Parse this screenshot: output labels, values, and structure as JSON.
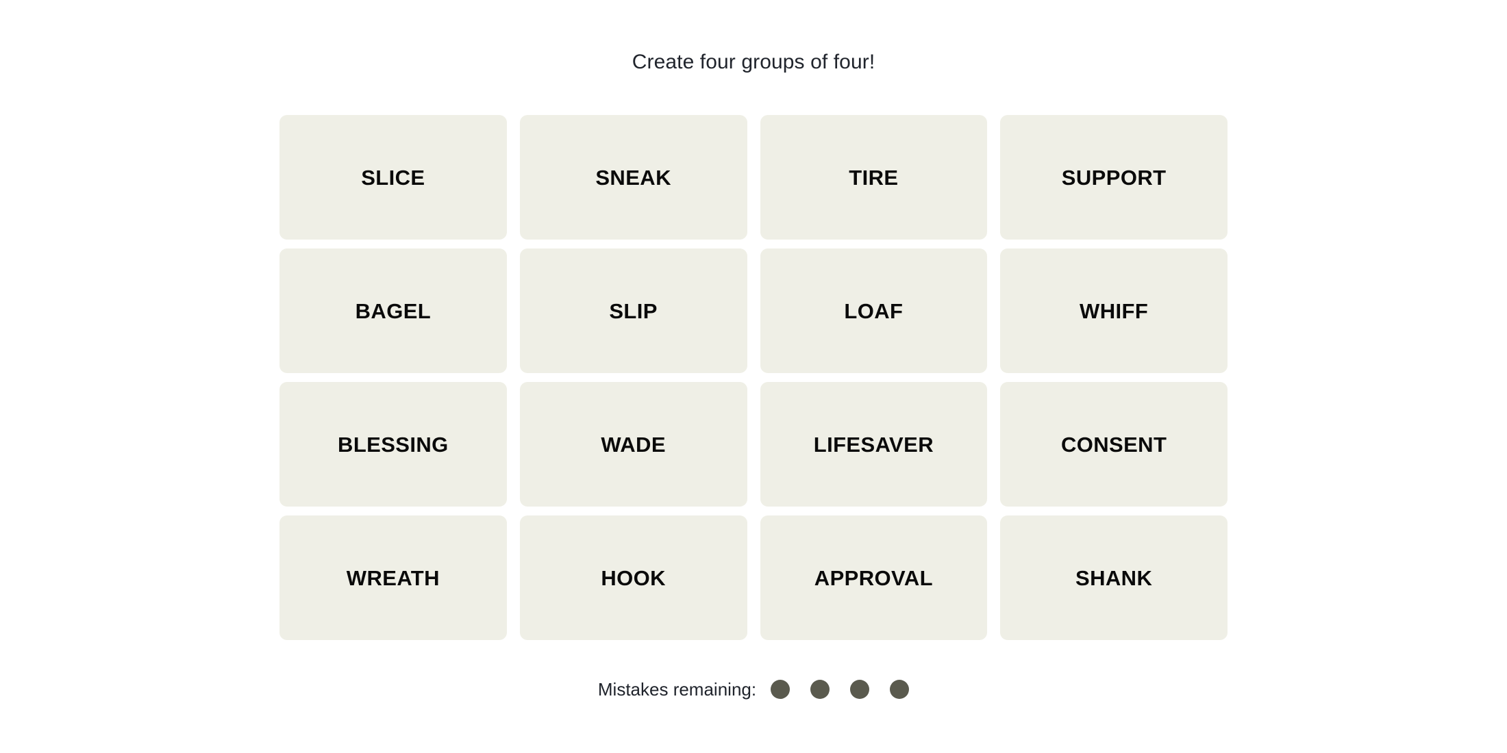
{
  "game": {
    "instruction": "Create four groups of four!",
    "board": {
      "rows": [
        [
          "SLICE",
          "SNEAK",
          "TIRE",
          "SUPPORT"
        ],
        [
          "BAGEL",
          "SLIP",
          "LOAF",
          "WHIFF"
        ],
        [
          "BLESSING",
          "WADE",
          "LIFESAVER",
          "CONSENT"
        ],
        [
          "WREATH",
          "HOOK",
          "APPROVAL",
          "SHANK"
        ]
      ],
      "tiles": [
        "SLICE",
        "SNEAK",
        "TIRE",
        "SUPPORT",
        "BAGEL",
        "SLIP",
        "LOAF",
        "WHIFF",
        "BLESSING",
        "WADE",
        "LIFESAVER",
        "CONSENT",
        "WREATH",
        "HOOK",
        "APPROVAL",
        "SHANK"
      ]
    },
    "footer": {
      "mistakes_label": "Mistakes remaining:",
      "mistakes_remaining": 4,
      "dots": [
        "dot",
        "dot",
        "dot",
        "dot"
      ]
    },
    "colors": {
      "page_background": "#ffffff",
      "tile_background": "#efefe6",
      "tile_text": "#0a0a0a",
      "body_text": "#20242c",
      "mistake_dot": "#5a5a4e"
    }
  }
}
